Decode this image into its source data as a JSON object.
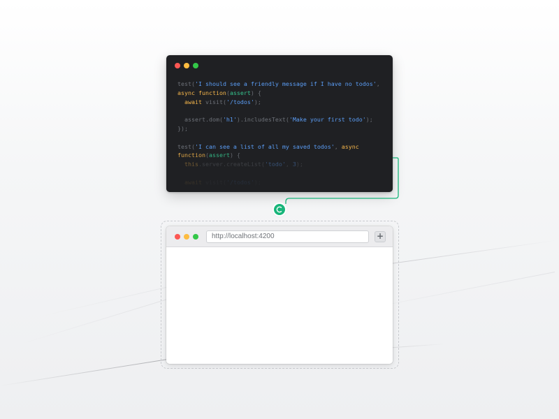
{
  "editor": {
    "window_dots": [
      "close",
      "minimize",
      "maximize"
    ],
    "code_lines": [
      [
        {
          "t": "test(",
          "c": "plain"
        },
        {
          "t": "'I should see a friendly message if I have no todos'",
          "c": "str"
        },
        {
          "t": ",",
          "c": "plain"
        }
      ],
      [
        {
          "t": "async function",
          "c": "kw"
        },
        {
          "t": "(",
          "c": "plain"
        },
        {
          "t": "assert",
          "c": "var"
        },
        {
          "t": ") {",
          "c": "plain"
        }
      ],
      [
        {
          "t": "  ",
          "c": "plain"
        },
        {
          "t": "await",
          "c": "kw"
        },
        {
          "t": " visit(",
          "c": "plain"
        },
        {
          "t": "'/todos'",
          "c": "str"
        },
        {
          "t": ");",
          "c": "plain"
        }
      ],
      [],
      [
        {
          "t": "  assert.dom(",
          "c": "plain"
        },
        {
          "t": "'h1'",
          "c": "str"
        },
        {
          "t": ").includesText(",
          "c": "plain"
        },
        {
          "t": "'Make your first todo'",
          "c": "str"
        },
        {
          "t": ");",
          "c": "plain"
        }
      ],
      [
        {
          "t": "});",
          "c": "plain"
        }
      ],
      [],
      [
        {
          "t": "test(",
          "c": "plain"
        },
        {
          "t": "'I can see a list of all my saved todos'",
          "c": "str"
        },
        {
          "t": ", ",
          "c": "plain"
        },
        {
          "t": "async",
          "c": "kw"
        }
      ],
      [
        {
          "t": "function",
          "c": "kw"
        },
        {
          "t": "(",
          "c": "plain"
        },
        {
          "t": "assert",
          "c": "var"
        },
        {
          "t": ") {",
          "c": "plain"
        }
      ],
      [
        {
          "t": "  ",
          "c": "plain"
        },
        {
          "t": "this",
          "c": "kw"
        },
        {
          "t": ".server.createList(",
          "c": "plain"
        },
        {
          "t": "'todo'",
          "c": "str"
        },
        {
          "t": ", ",
          "c": "plain"
        },
        {
          "t": "3",
          "c": "str"
        },
        {
          "t": ");",
          "c": "plain"
        }
      ],
      [],
      [
        {
          "t": "  ",
          "c": "plain"
        },
        {
          "t": "await",
          "c": "kw"
        },
        {
          "t": " visit(",
          "c": "plain"
        },
        {
          "t": "'/todos'",
          "c": "str"
        },
        {
          "t": ");",
          "c": "plain"
        }
      ]
    ]
  },
  "connector": {
    "color": "#18b57a",
    "icon": "loading-spinner-icon"
  },
  "browser": {
    "url": "http://localhost:4200",
    "new_tab_label": "+",
    "window_dots": [
      "close",
      "minimize",
      "maximize"
    ]
  },
  "colors": {
    "editor_bg": "#1f2023",
    "string": "#5b9df5",
    "keyword": "#f4b54b",
    "variable": "#36c48e",
    "accent_green": "#18b57a"
  }
}
